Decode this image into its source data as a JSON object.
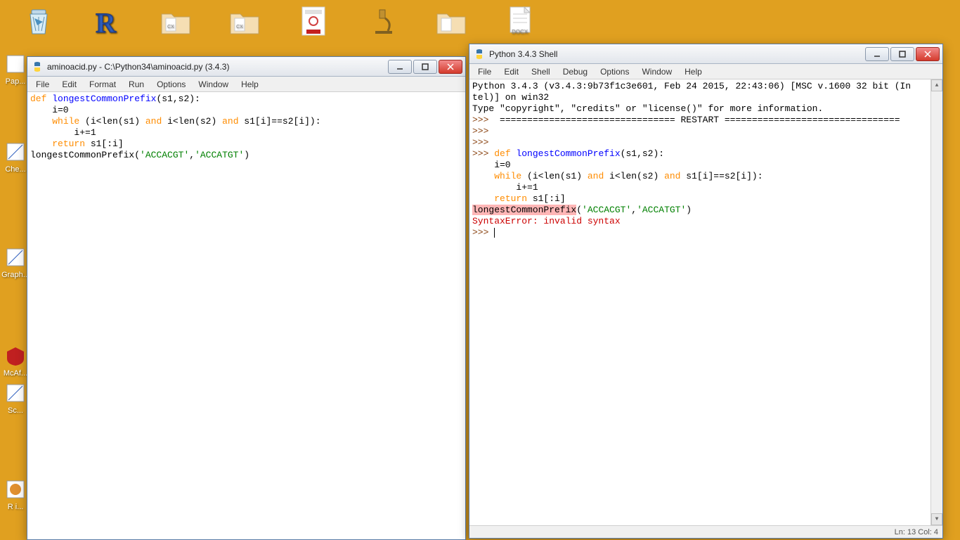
{
  "desktop": {
    "icons": [
      {
        "name": "recycle-bin",
        "label": ""
      },
      {
        "name": "r-app",
        "label": ""
      },
      {
        "name": "folder-1",
        "label": ""
      },
      {
        "name": "folder-2",
        "label": ""
      },
      {
        "name": "pdf-file",
        "label": ""
      },
      {
        "name": "microscope",
        "label": ""
      },
      {
        "name": "folder-3",
        "label": ""
      },
      {
        "name": "docx-file",
        "label": ""
      },
      {
        "name": "papers",
        "label": "Pap..."
      },
      {
        "name": "chem",
        "label": "Che..."
      },
      {
        "name": "graph",
        "label": "Graph..."
      },
      {
        "name": "mcafee",
        "label": "McAf..."
      },
      {
        "name": "sc",
        "label": "Sc..."
      },
      {
        "name": "ri",
        "label": "R i..."
      }
    ]
  },
  "editor_window": {
    "title": "aminoacid.py - C:\\Python34\\aminoacid.py (3.4.3)",
    "menus": [
      "File",
      "Edit",
      "Format",
      "Run",
      "Options",
      "Window",
      "Help"
    ],
    "code": {
      "l1_def": "def ",
      "l1_name": "longestCommonPrefix",
      "l1_rest": "(s1,s2):",
      "l2": "    i=0",
      "l3a": "    ",
      "l3_while": "while ",
      "l3b": "(i<len(s1) ",
      "l3_and1": "and",
      "l3c": " i<len(s2) ",
      "l3_and2": "and",
      "l3d": " s1[i]==s2[i]):",
      "l4": "        i+=1",
      "l5a": "    ",
      "l5_return": "return",
      "l5b": " s1[:i]",
      "l6a": "longestCommonPrefix(",
      "l6_s1": "'ACCACGT'",
      "l6b": ",",
      "l6_s2": "'ACCATGT'",
      "l6c": ")"
    }
  },
  "shell_window": {
    "title": "Python 3.4.3 Shell",
    "menus": [
      "File",
      "Edit",
      "Shell",
      "Debug",
      "Options",
      "Window",
      "Help"
    ],
    "content": {
      "banner1": "Python 3.4.3 (v3.4.3:9b73f1c3e601, Feb 24 2015, 22:43:06) [MSC v.1600 32 bit (In",
      "banner2": "tel)] on win32",
      "banner3": "Type \"copyright\", \"credits\" or \"license()\" for more information.",
      "prompt": ">>> ",
      "restart": " ================================ RESTART ================================",
      "def": "def ",
      "fname": "longestCommonPrefix",
      "sig": "(s1,s2):",
      "l_i": "    i=0",
      "l_while": "    while ",
      "l_while_b": "(i<len(s1) ",
      "l_and1": "and",
      "l_while_c": " i<len(s2) ",
      "l_and2": "and",
      "l_while_d": " s1[i]==s2[i]):",
      "l_inc": "        i+=1",
      "l_ret_a": "    ",
      "l_return": "return",
      "l_ret_b": " s1[:i]",
      "call_name": "longestCommonPrefix",
      "call_a": "(",
      "call_s1": "'ACCACGT'",
      "call_c": ",",
      "call_s2": "'ACCATGT'",
      "call_e": ")",
      "error": "SyntaxError: invalid syntax"
    },
    "status": "Ln: 13 Col: 4"
  }
}
